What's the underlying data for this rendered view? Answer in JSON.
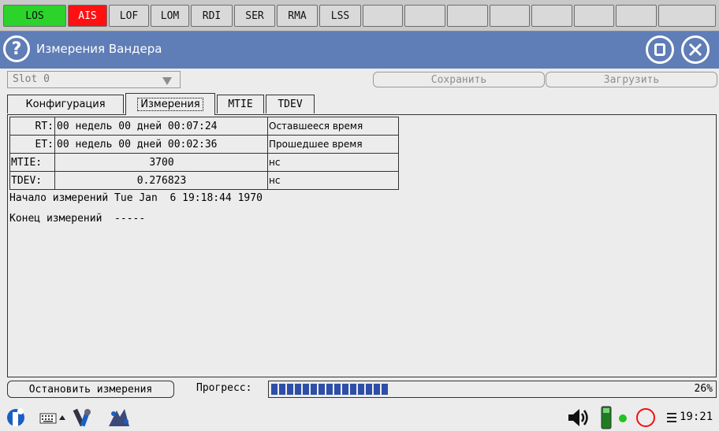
{
  "alarms": [
    {
      "label": "LOS",
      "state": "green"
    },
    {
      "label": "AIS",
      "state": "red"
    },
    {
      "label": "LOF",
      "state": "off"
    },
    {
      "label": "LOM",
      "state": "off"
    },
    {
      "label": "RDI",
      "state": "off"
    },
    {
      "label": "SER",
      "state": "off"
    },
    {
      "label": "RMA",
      "state": "off"
    },
    {
      "label": "LSS",
      "state": "off"
    },
    {
      "label": "",
      "state": "off"
    },
    {
      "label": "",
      "state": "off"
    },
    {
      "label": "",
      "state": "off"
    },
    {
      "label": "",
      "state": "off"
    },
    {
      "label": "",
      "state": "off"
    },
    {
      "label": "",
      "state": "off"
    },
    {
      "label": "",
      "state": "off"
    },
    {
      "label": "",
      "state": "off"
    }
  ],
  "colors": {
    "title_bar": "#5f7db6",
    "alarm_green": "#2bd32b",
    "alarm_red": "#ff1111",
    "progress": "#2e4fa8"
  },
  "title_bar": {
    "help_icon": "?",
    "title": "Измерения Вандера",
    "stop_icon": "stop-icon",
    "close_icon": "close-icon"
  },
  "toolbar": {
    "slot_value": "Slot 0",
    "save_label": "Сохранить",
    "load_label": "Загрузить"
  },
  "tabs": [
    {
      "label": "Конфигурация",
      "active": false
    },
    {
      "label": "Измерения",
      "active": true
    },
    {
      "label": "MTIE",
      "active": false
    },
    {
      "label": "TDEV",
      "active": false
    }
  ],
  "measurements": {
    "rows": [
      {
        "key": "RT:",
        "value": "00 недель 00 дней 00:07:24",
        "unit": "Оставшееся время"
      },
      {
        "key": "ET:",
        "value": "00 недель 00 дней 00:02:36",
        "unit": "Прошедшее время"
      },
      {
        "key": "MTIE:",
        "value": "3700",
        "unit": "нс"
      },
      {
        "key": "TDEV:",
        "value": "0.276823",
        "unit": "нс"
      }
    ],
    "start_line": "Начало измерений Tue Jan  6 19:18:44 1970",
    "end_line": "Конец измерений  -----"
  },
  "bottom": {
    "stop_label": "Остановить измерения",
    "progress_label": "Прогресс:",
    "progress_value": 26,
    "progress_text": "26%"
  },
  "taskbar": {
    "icons": [
      "app-menu-icon",
      "keyboard-icon",
      "tool-icon",
      "network-icon"
    ],
    "tray_icons": [
      "volume-icon",
      "battery-icon",
      "status-led-icon",
      "record-icon",
      "menu-icon"
    ],
    "clock": "19:21"
  }
}
